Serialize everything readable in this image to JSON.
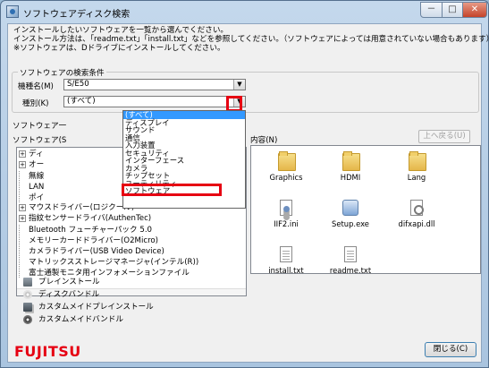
{
  "window": {
    "title": "ソフトウェアディスク検索",
    "min_glyph": "－",
    "max_glyph": "□",
    "close_glyph": "✕"
  },
  "description": {
    "line1": "インストールしたいソフトウェアを一覧から選んでください。",
    "line2": "インストール方法は、「readme.txt」「install.txt」などを参照してください。（ソフトウェアによっては用意されていない場合もあります）",
    "line3": "※ソフトウェアは、Dドライブにインストールしてください。"
  },
  "search": {
    "legend": "ソフトウェアの検索条件",
    "model_label": "機種名(M)",
    "model_value": "S/E50",
    "category_label": "種別(K)",
    "category_value": "(すべて)",
    "dropdown_options": [
      "(すべて)",
      "ディスプレイ",
      "サウンド",
      "通信",
      "入力装置",
      "セキュリティ",
      "インターフェース",
      "カメラ",
      "チップセット",
      "ユーティリティ",
      "ソフトウェア"
    ],
    "dropdown_selected_index": 0
  },
  "tree": {
    "legend_partial": "ソフトウェア一",
    "label_partial": "ソフトウェア(S",
    "items": [
      {
        "text": "ディ",
        "expandable": true
      },
      {
        "text": "オー",
        "expandable": true
      },
      {
        "text": "無線",
        "expandable": false
      },
      {
        "text": "LAN",
        "expandable": false
      },
      {
        "text": "ポイ",
        "expandable": false
      },
      {
        "text": "マウスドライバー(ロジクール)",
        "expandable": true
      },
      {
        "text": "指紋センサードライバ(AuthenTec)",
        "expandable": true
      },
      {
        "text": "Bluetooth フューチャーパック 5.0",
        "expandable": false
      },
      {
        "text": "メモリーカードドライバー(O2Micro)",
        "expandable": false
      },
      {
        "text": "カメラドライバー(USB Video Device)",
        "expandable": false
      },
      {
        "text": "マトリックスストレージマネージャ(インテル(R))",
        "expandable": false
      },
      {
        "text": "富士通製モニタ用インフォメーションファイル",
        "expandable": false
      }
    ]
  },
  "content": {
    "label": "内容(N)",
    "up_button": "上へ戻る(U)",
    "files": [
      {
        "name": "Graphics",
        "kind": "folder"
      },
      {
        "name": "HDMI",
        "kind": "folder"
      },
      {
        "name": "Lang",
        "kind": "folder"
      },
      {
        "name": "IIF2.ini",
        "kind": "ini"
      },
      {
        "name": "Setup.exe",
        "kind": "exe"
      },
      {
        "name": "difxapi.dll",
        "kind": "dll"
      },
      {
        "name": "install.txt",
        "kind": "txt"
      },
      {
        "name": "readme.txt",
        "kind": "txt"
      }
    ]
  },
  "legend": {
    "items": [
      {
        "label": "プレインストール",
        "icon": "preinstall-icon"
      },
      {
        "label": "ディスクバンドル",
        "icon": "disk-bundle-icon"
      },
      {
        "label": "カスタムメイドプレインストール",
        "icon": "custom-preinstall-icon"
      },
      {
        "label": "カスタムメイドバンドル",
        "icon": "custom-bundle-icon"
      }
    ]
  },
  "footer": {
    "logo": "FUJITSU",
    "close_button": "閉じる(C)"
  },
  "colors": {
    "highlight": "#e60012",
    "selection": "#3399ff"
  }
}
